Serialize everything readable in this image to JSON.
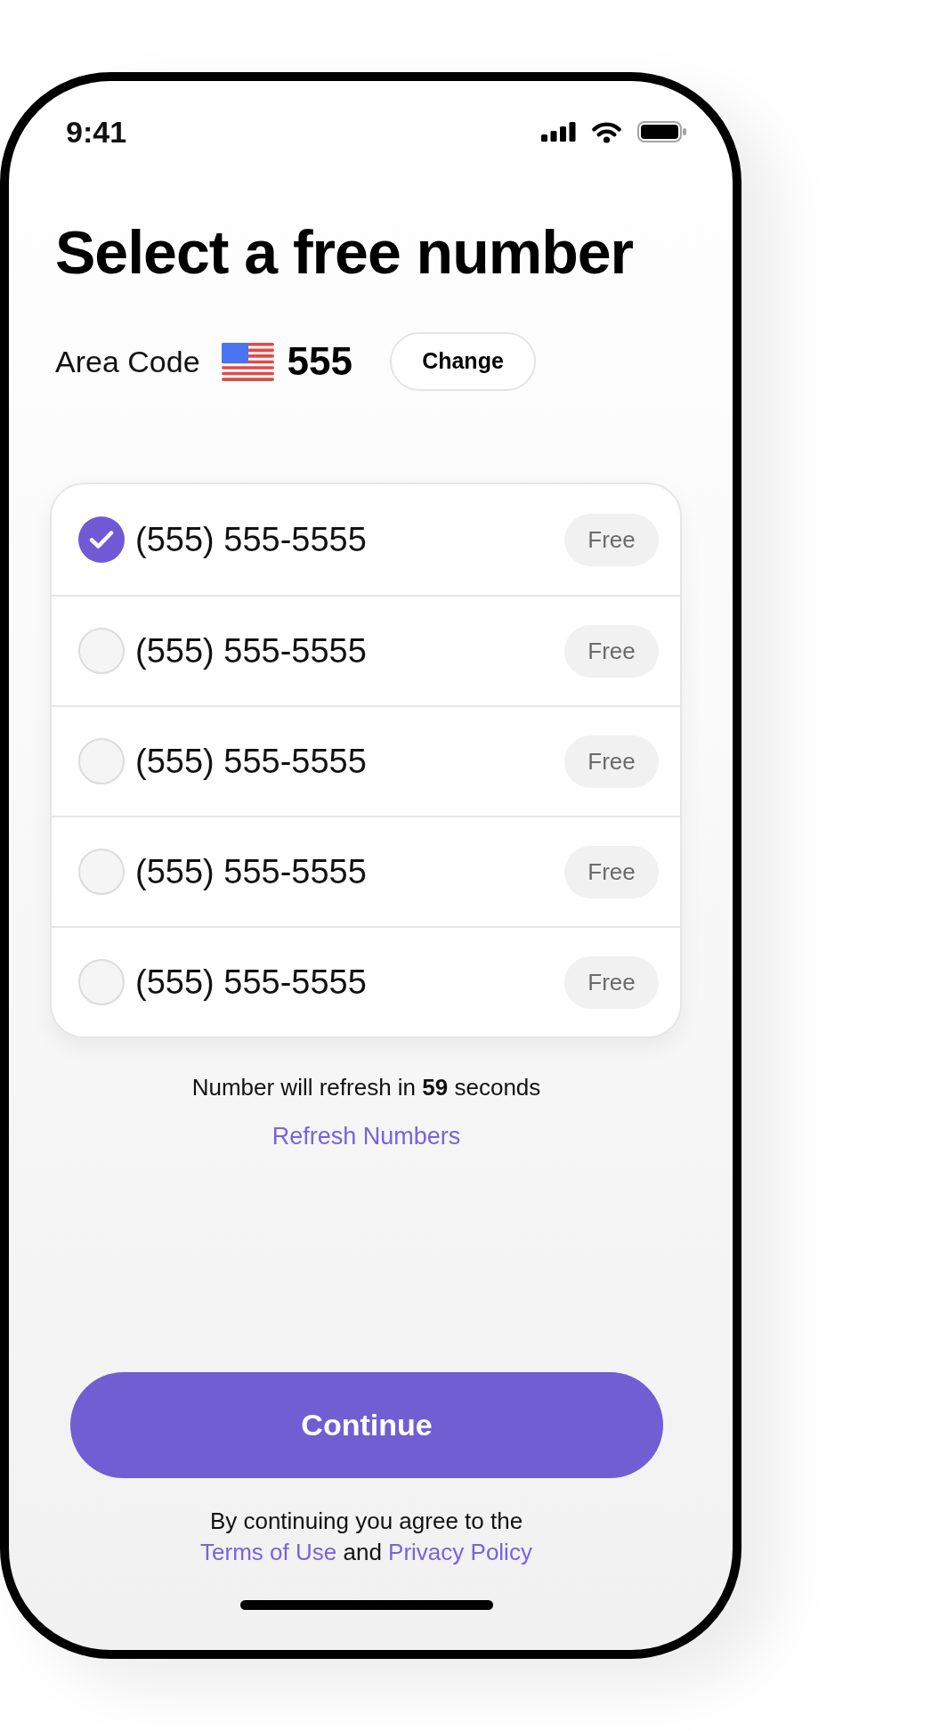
{
  "status_bar": {
    "time": "9:41"
  },
  "title": "Select a free number",
  "area_code": {
    "label": "Area Code",
    "code": "555",
    "change_button": "Change"
  },
  "numbers": [
    {
      "number": "(555) 555-5555",
      "badge": "Free",
      "selected": true
    },
    {
      "number": "(555) 555-5555",
      "badge": "Free",
      "selected": false
    },
    {
      "number": "(555) 555-5555",
      "badge": "Free",
      "selected": false
    },
    {
      "number": "(555) 555-5555",
      "badge": "Free",
      "selected": false
    },
    {
      "number": "(555) 555-5555",
      "badge": "Free",
      "selected": false
    }
  ],
  "refresh_notice": "Number will refresh in **59** seconds",
  "refresh_link": "Refresh Numbers",
  "continue_button": "Continue",
  "legal": [
    {
      "kind": "text",
      "text": "By continuing you agree to the "
    },
    {
      "kind": "link",
      "text": "Terms of Use"
    },
    {
      "kind": "text",
      "text": " and "
    },
    {
      "kind": "link",
      "text": "Privacy Policy"
    }
  ]
}
